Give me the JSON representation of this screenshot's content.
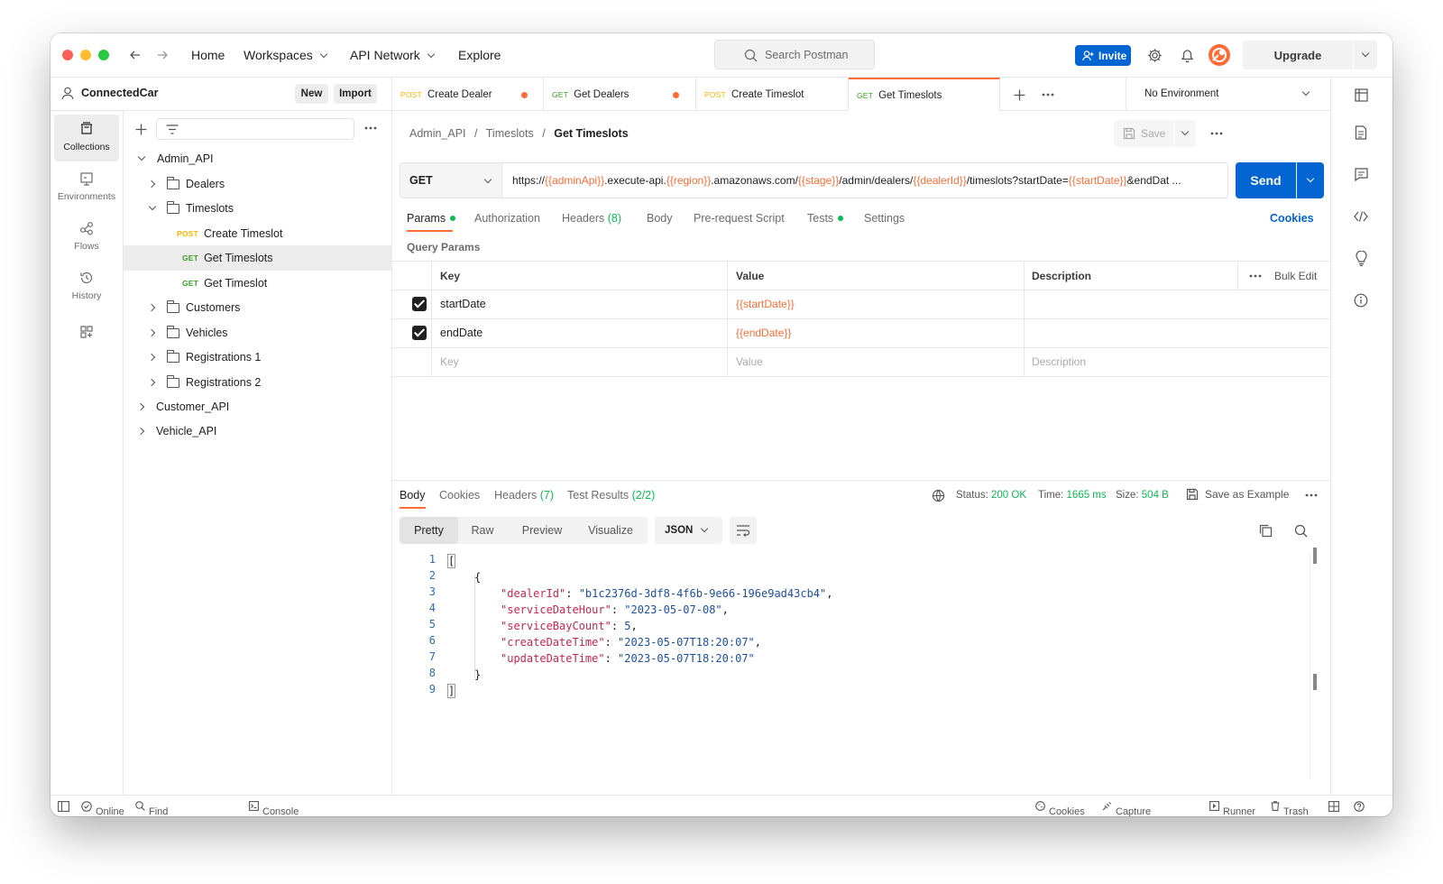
{
  "header": {
    "nav": [
      "Home",
      "Workspaces",
      "API Network",
      "Explore"
    ],
    "search_placeholder": "Search Postman",
    "invite_label": "Invite",
    "upgrade_label": "Upgrade"
  },
  "workspace": {
    "name": "ConnectedCar",
    "new_label": "New",
    "import_label": "Import"
  },
  "rail": {
    "items": [
      "Collections",
      "Environments",
      "Flows",
      "History"
    ]
  },
  "sidebar": {
    "tree": [
      {
        "label": "Admin_API"
      },
      {
        "label": "Dealers"
      },
      {
        "label": "Timeslots"
      },
      {
        "method": "POST",
        "label": "Create Timeslot"
      },
      {
        "method": "GET",
        "label": "Get Timeslots"
      },
      {
        "method": "GET",
        "label": "Get Timeslot"
      },
      {
        "label": "Customers"
      },
      {
        "label": "Vehicles"
      },
      {
        "label": "Registrations 1"
      },
      {
        "label": "Registrations 2"
      },
      {
        "label": "Customer_API"
      },
      {
        "label": "Vehicle_API"
      }
    ]
  },
  "tabs": [
    {
      "method": "POST",
      "label": "Create Dealer"
    },
    {
      "method": "GET",
      "label": "Get Dealers"
    },
    {
      "method": "POST",
      "label": "Create Timeslot"
    },
    {
      "method": "GET",
      "label": "Get Timeslots"
    }
  ],
  "environment": "No Environment",
  "breadcrumb": {
    "a": "Admin_API",
    "b": "Timeslots",
    "c": "Get Timeslots",
    "sep": "/"
  },
  "save_label": "Save",
  "request": {
    "method": "GET",
    "url_parts": [
      {
        "t": "https://",
        "v": false
      },
      {
        "t": "{{adminApi}}",
        "v": true
      },
      {
        "t": ".execute-api.",
        "v": false
      },
      {
        "t": "{{region}}",
        "v": true
      },
      {
        "t": ".amazonaws.com/",
        "v": false
      },
      {
        "t": "{{stage}}",
        "v": true
      },
      {
        "t": "/admin/dealers/",
        "v": false
      },
      {
        "t": "{{dealerId}}",
        "v": true
      },
      {
        "t": "/timeslots?startDate=",
        "v": false
      },
      {
        "t": "{{startDate}}",
        "v": true
      },
      {
        "t": "&endDat ...",
        "v": false
      }
    ],
    "send_label": "Send"
  },
  "req_tabs": {
    "params": "Params",
    "auth": "Authorization",
    "headers": "Headers",
    "headers_count": "(8)",
    "body": "Body",
    "prereq": "Pre-request Script",
    "tests": "Tests",
    "settings": "Settings",
    "cookies": "Cookies"
  },
  "query_params": {
    "title": "Query Params",
    "col_key": "Key",
    "col_value": "Value",
    "col_desc": "Description",
    "bulk_edit": "Bulk Edit",
    "rows": [
      {
        "key": "startDate",
        "value": "{{startDate}}"
      },
      {
        "key": "endDate",
        "value": "{{endDate}}"
      }
    ],
    "ph_key": "Key",
    "ph_value": "Value",
    "ph_desc": "Description"
  },
  "response": {
    "tabs": {
      "body": "Body",
      "cookies": "Cookies",
      "headers": "Headers",
      "headers_count": "(7)",
      "tests": "Test Results",
      "tests_count": "(2/2)"
    },
    "status_label": "Status:",
    "status": "200 OK",
    "time_label": "Time:",
    "time": "1665 ms",
    "size_label": "Size:",
    "size": "504 B",
    "save_example": "Save as Example",
    "views": [
      "Pretty",
      "Raw",
      "Preview",
      "Visualize"
    ],
    "format": "JSON",
    "lines": [
      "1",
      "2",
      "3",
      "4",
      "5",
      "6",
      "7",
      "8",
      "9"
    ],
    "json": {
      "dealerId": "\"b1c2376d-3df8-4f6b-9e66-196e9ad43cb4\"",
      "serviceDateHour": "\"2023-05-07-08\"",
      "serviceBayCount": "5",
      "createDateTime": "\"2023-05-07T18:20:07\"",
      "updateDateTime": "\"2023-05-07T18:20:07\""
    },
    "json_keys": {
      "dealerId": "\"dealerId\"",
      "serviceDateHour": "\"serviceDateHour\"",
      "serviceBayCount": "\"serviceBayCount\"",
      "createDateTime": "\"createDateTime\"",
      "updateDateTime": "\"updateDateTime\""
    }
  },
  "statusbar": {
    "online": "Online",
    "find": "Find and Replace",
    "console": "Console",
    "cookies": "Cookies",
    "capture": "Capture requests",
    "runner": "Runner",
    "trash": "Trash"
  },
  "colors": {
    "accent": "#ff6c37",
    "send": "#0265d2",
    "invite": "#0265d2",
    "green": "#0cbb52"
  }
}
